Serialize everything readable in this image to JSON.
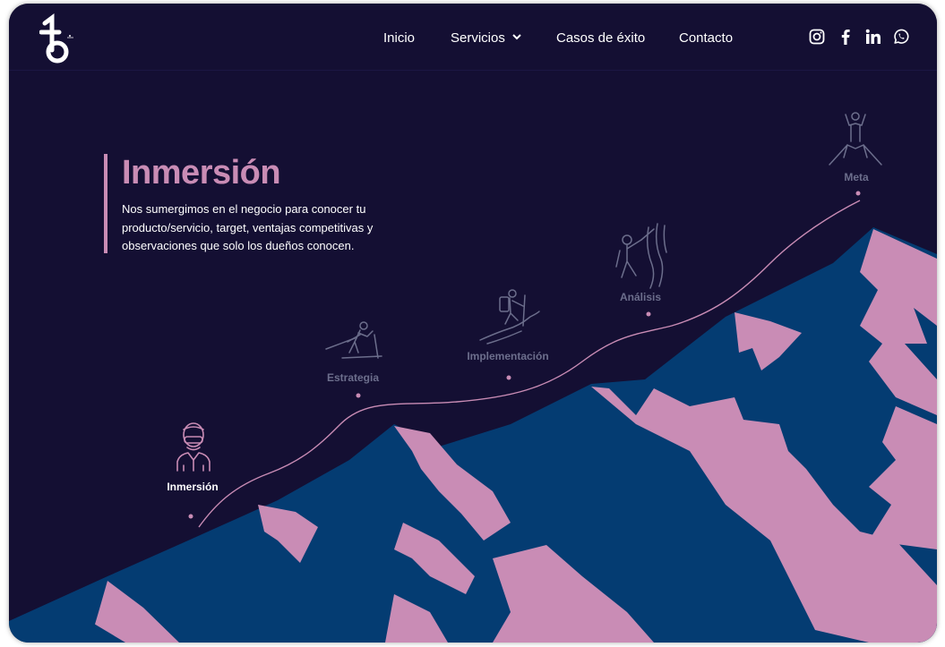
{
  "nav": {
    "links": [
      "Inicio",
      "Servicios",
      "Casos de éxito",
      "Contacto"
    ]
  },
  "social": [
    "instagram-icon",
    "facebook-icon",
    "linkedin-icon",
    "whatsapp-icon"
  ],
  "hero": {
    "title": "Inmersión",
    "description": "Nos sumergimos en el negocio para conocer tu producto/servicio, target, ventajas competitivas y observaciones que solo los dueños conocen."
  },
  "stages": [
    {
      "label": "Inmersión",
      "icon": "person-icon",
      "active": true
    },
    {
      "label": "Estrategia",
      "icon": "skier-icon",
      "active": false
    },
    {
      "label": "Implementación",
      "icon": "hiker-icon",
      "active": false
    },
    {
      "label": "Análisis",
      "icon": "climber-icon",
      "active": false
    },
    {
      "label": "Meta",
      "icon": "summit-icon",
      "active": false
    }
  ],
  "colors": {
    "background": "#140f33",
    "mountain_blue": "#043c72",
    "mountain_pink": "#c98cb5",
    "inactive_label": "#6c6e8c"
  }
}
